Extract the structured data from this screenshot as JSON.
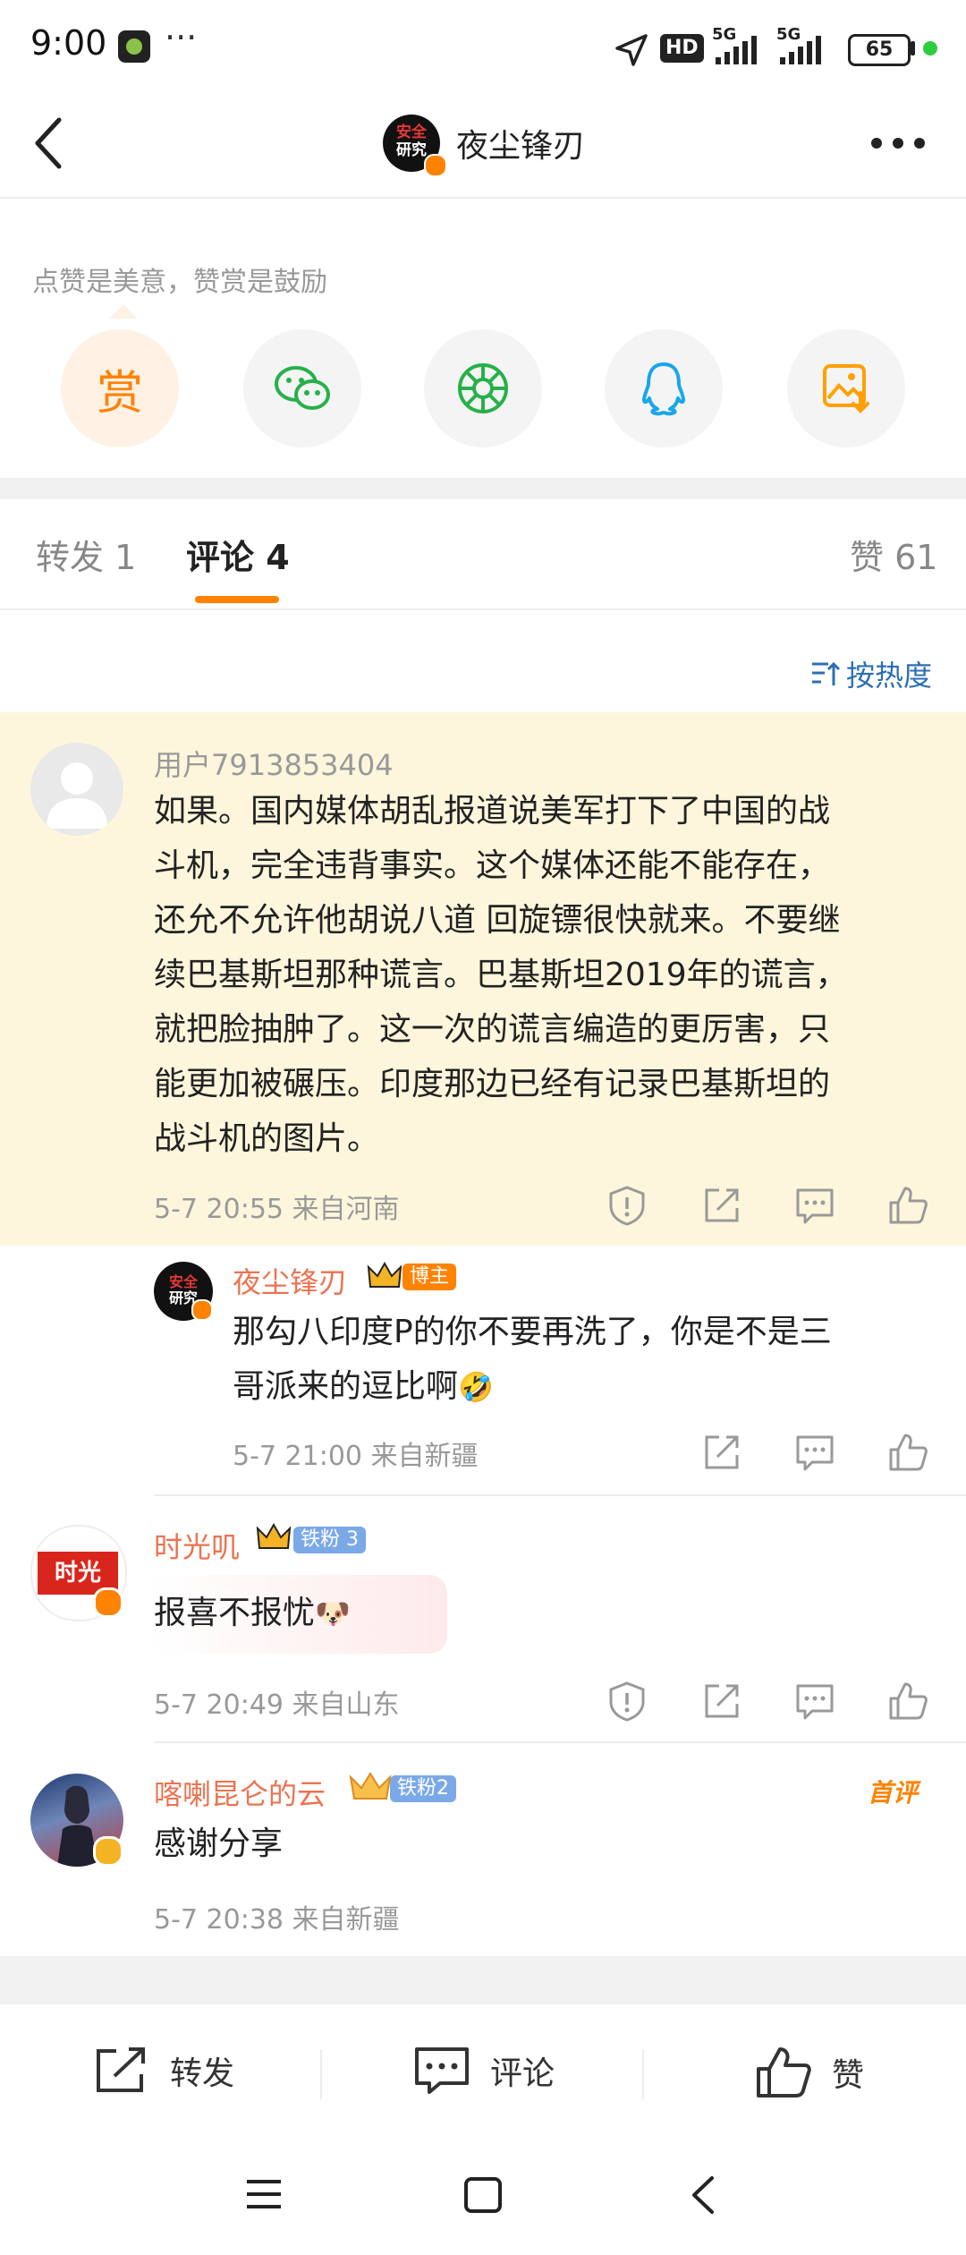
{
  "status_bar": {
    "time": "9:00",
    "more": "···",
    "battery": "65",
    "network1": "5G",
    "network2": "5G",
    "hd": "HD"
  },
  "header": {
    "title": "夜尘锋刃",
    "avatar_text_top": "安全",
    "avatar_text_bottom": "研究"
  },
  "reward": {
    "hint": "点赞是美意，赞赏是鼓励",
    "reward_icon_label": "赏"
  },
  "tabs": {
    "repost": "转发 1",
    "comment": "评论 4",
    "like": "赞 61"
  },
  "sort": {
    "label": "按热度"
  },
  "comments": [
    {
      "user": "用户7913853404",
      "text_lines": [
        "如果。国内媒体胡乱报道说美军打下了中国的战",
        "斗机，完全违背事实。这个媒体还能不能存在，",
        "还允不允许他胡说八道 回旋镖很快就来。不要继",
        "续巴基斯坦那种谎言。巴基斯坦2019年的谎言，",
        "就把脸抽肿了。这一次的谎言编造的更厉害，只",
        "能更加被碾压。印度那边已经有记录巴基斯坦的",
        "战斗机的图片。"
      ],
      "meta": "5-7 20:55  来自河南"
    },
    {
      "user": "夜尘锋刃",
      "badge": "博主",
      "text_lines": [
        "那勾八印度P的你不要再洗了，你是不是三",
        "哥派来的逗比啊"
      ],
      "emoji": "🤣",
      "meta": "5-7 21:00  来自新疆",
      "avatar_text_top": "安全",
      "avatar_text_bottom": "研究"
    },
    {
      "user": "时光叽",
      "badge": "铁粉 3",
      "text": "报喜不报忧",
      "emoji": "🐶",
      "meta": "5-7 20:49  来自山东",
      "avatar_text": "时光"
    },
    {
      "user": "喀喇昆仑的云",
      "badge": "铁粉2",
      "tag": "首评",
      "text": "感谢分享",
      "meta": "5-7 20:38  来自新疆"
    }
  ],
  "bottom_bar": {
    "repost": "转发",
    "comment": "评论",
    "like": "赞"
  },
  "colors": {
    "accent": "#ff8200",
    "link": "#2c6fb3",
    "name": "#eb7350",
    "highlight_bg": "#fdf6dc"
  }
}
